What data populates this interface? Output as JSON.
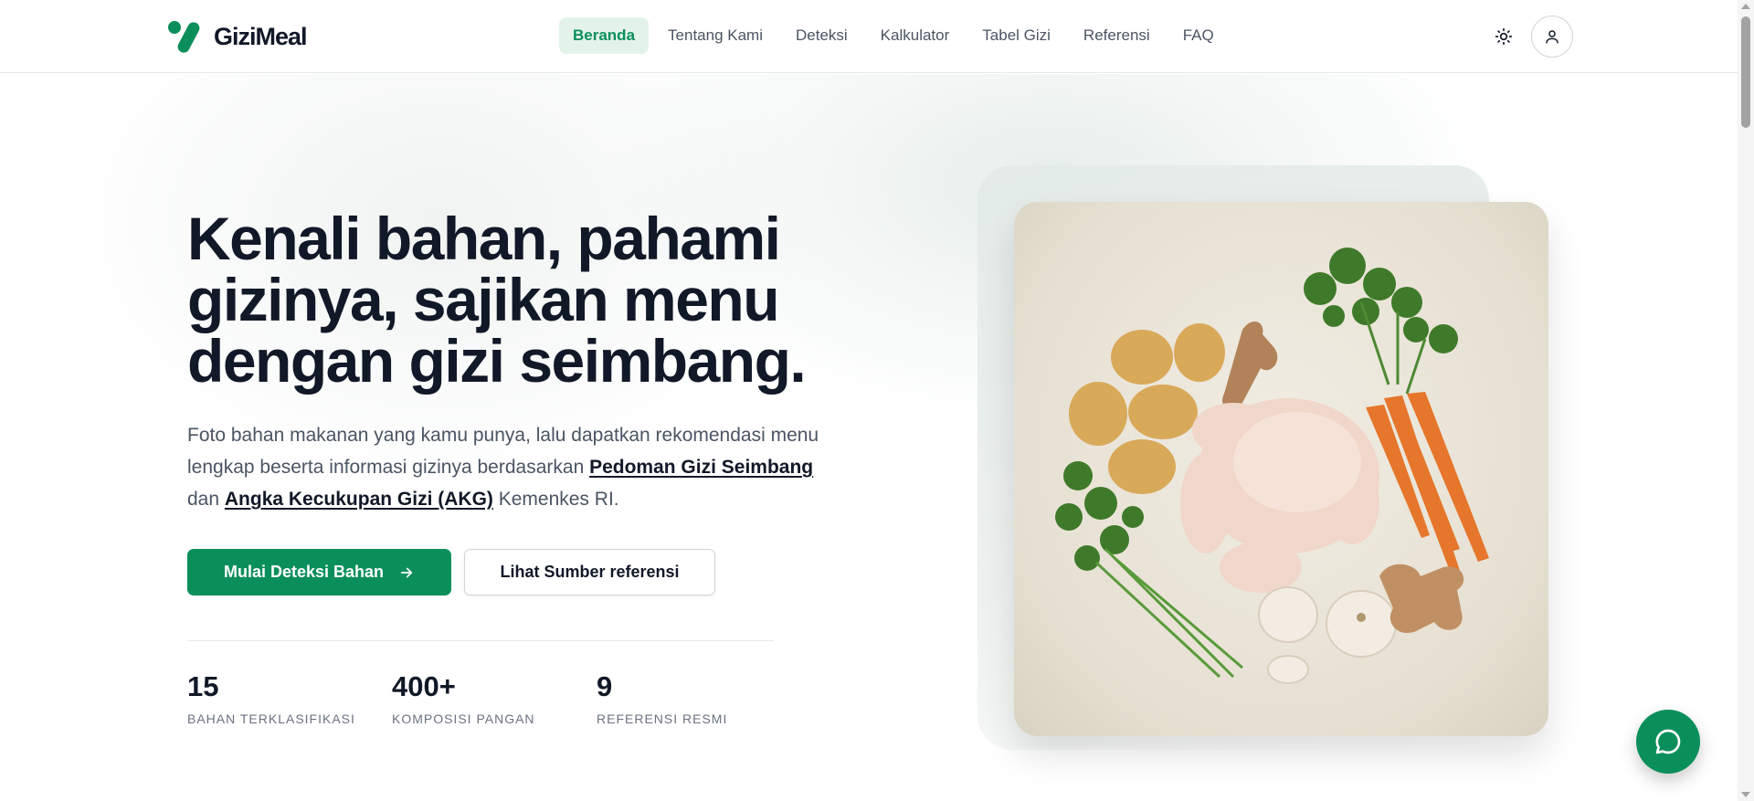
{
  "brand": {
    "name": "GiziMeal",
    "accent": "#0b8f5a"
  },
  "nav": {
    "items": [
      {
        "label": "Beranda",
        "active": true
      },
      {
        "label": "Tentang Kami",
        "active": false
      },
      {
        "label": "Deteksi",
        "active": false
      },
      {
        "label": "Kalkulator",
        "active": false
      },
      {
        "label": "Tabel Gizi",
        "active": false
      },
      {
        "label": "Referensi",
        "active": false
      },
      {
        "label": "FAQ",
        "active": false
      }
    ],
    "theme_icon": "sun-icon",
    "user_icon": "user-icon"
  },
  "hero": {
    "title": "Kenali bahan, pahami gizinya, sajikan menu dengan gizi seimbang.",
    "desc_part1": "Foto bahan makanan yang kamu punya, lalu dapatkan rekomendasi menu lengkap beserta informasi gizinya berdasarkan ",
    "desc_link1": "Pedoman Gizi Seimbang",
    "desc_part2": " dan ",
    "desc_link2": "Angka Kecukupan Gizi (AKG)",
    "desc_part3": " Kemenkes RI.",
    "primary_button": "Mulai Deteksi Bahan",
    "primary_button_icon": "arrow-right-icon",
    "secondary_button": "Lihat Sumber referensi",
    "image_icon": "food-ingredients-image"
  },
  "stats": [
    {
      "value": "15",
      "label": "BAHAN TERKLASIFIKASI"
    },
    {
      "value": "400+",
      "label": "KOMPOSISI PANGAN"
    },
    {
      "value": "9",
      "label": "REFERENSI RESMI"
    }
  ],
  "chat": {
    "icon": "chat-bubble-icon"
  }
}
